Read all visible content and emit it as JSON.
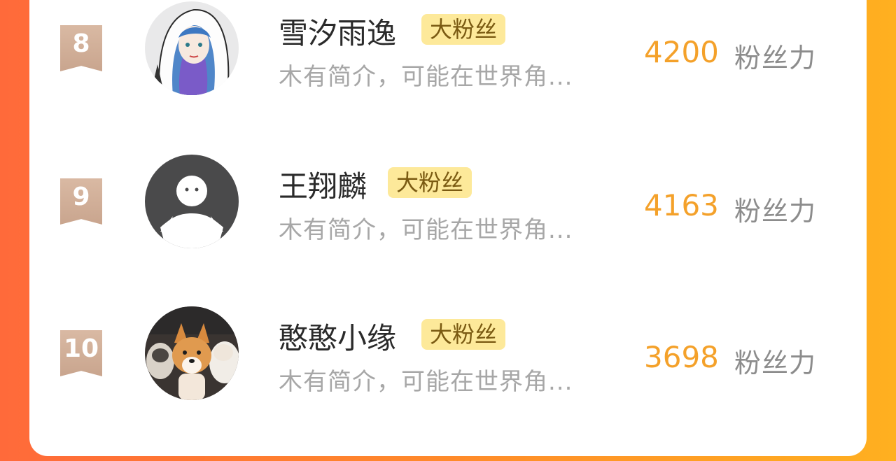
{
  "rows": [
    {
      "rank": "8",
      "name": "雪汐雨逸",
      "badge": "大粉丝",
      "bio": "木有简介，可能在世界角...",
      "score": "4200",
      "unit": "粉丝力",
      "avatar": "anime-avatar"
    },
    {
      "rank": "9",
      "name": "王翔麟",
      "badge": "大粉丝",
      "bio": "木有简介，可能在世界角...",
      "score": "4163",
      "unit": "粉丝力",
      "avatar": "default-avatar"
    },
    {
      "rank": "10",
      "name": "憨憨小缘",
      "badge": "大粉丝",
      "bio": "木有简介，可能在世界角...",
      "score": "3698",
      "unit": "粉丝力",
      "avatar": "dogs-avatar"
    }
  ],
  "colors": {
    "score": "#f4a12a",
    "badge_bg": "#fde99a",
    "rank_ribbon": "#cfae98"
  }
}
